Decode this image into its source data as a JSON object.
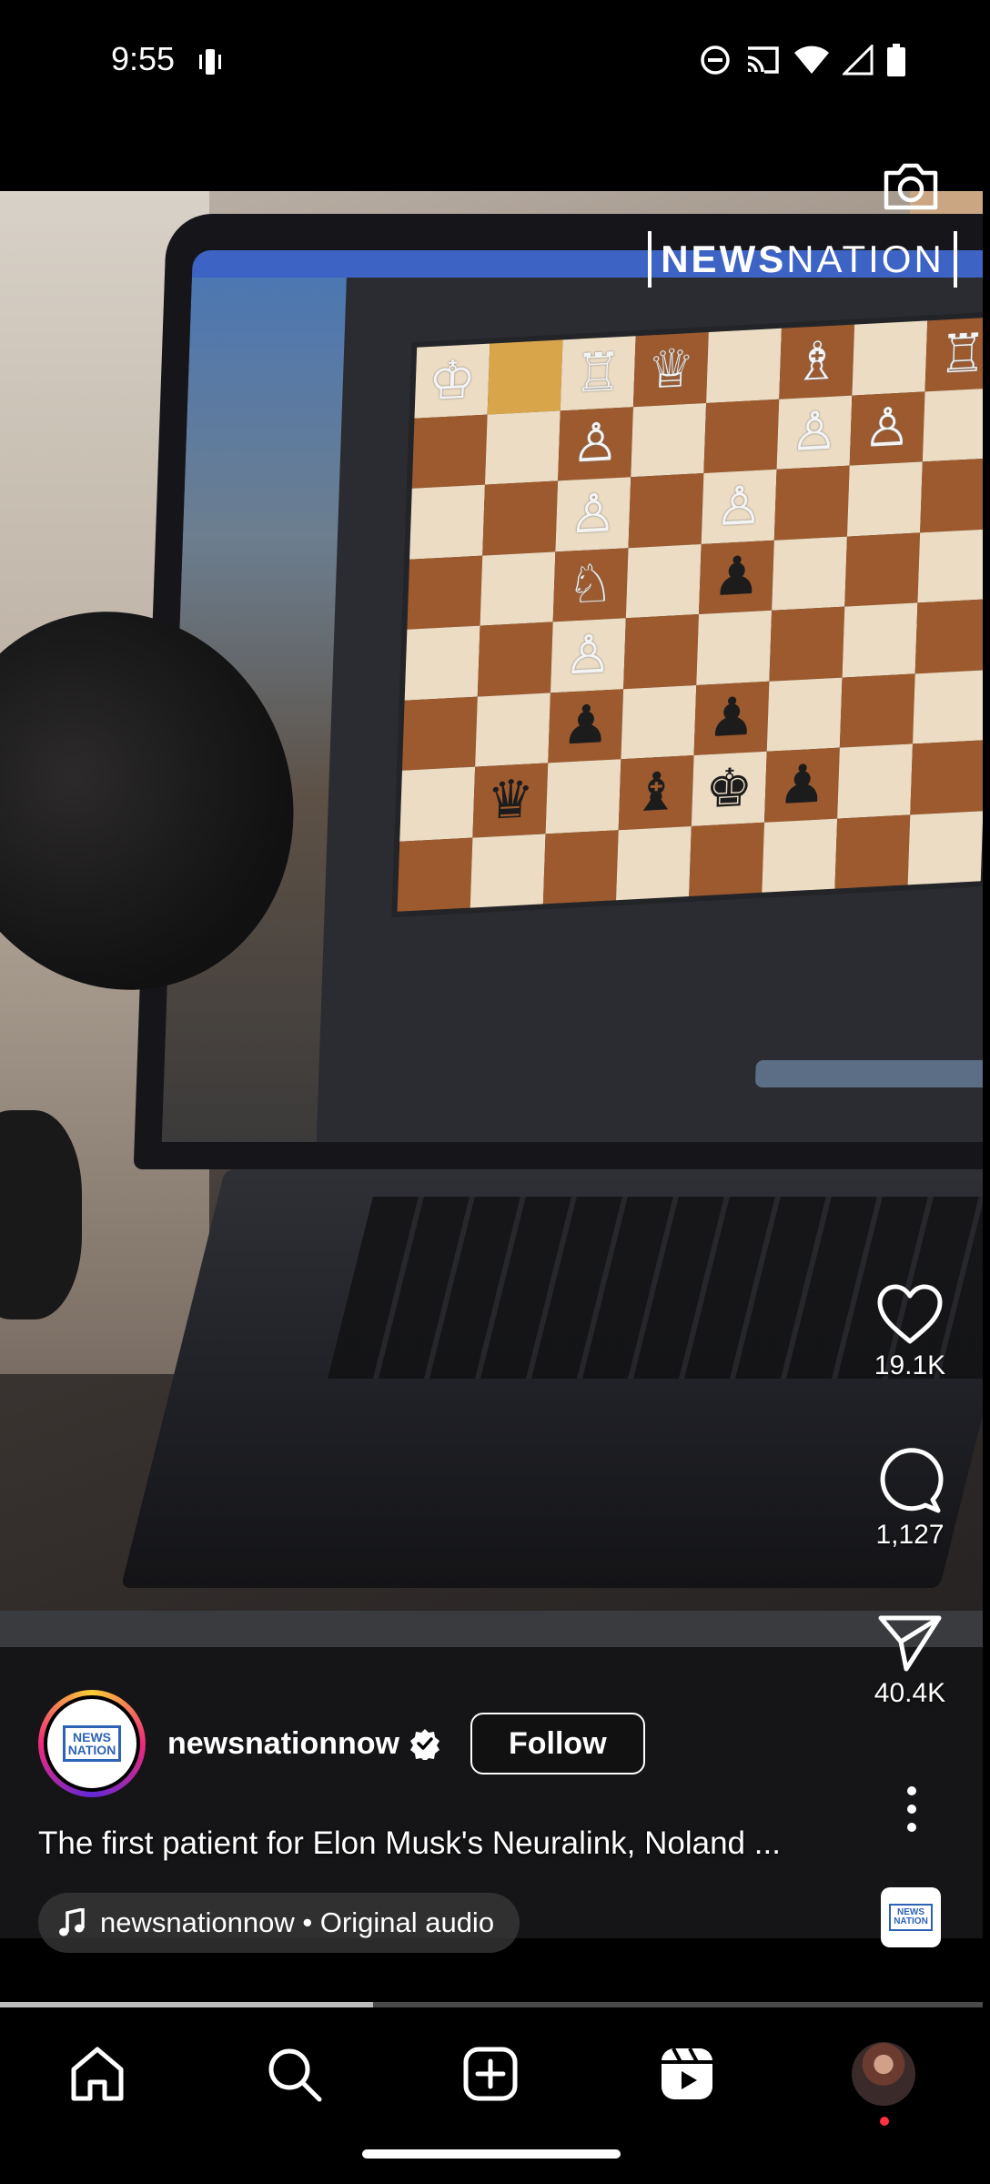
{
  "status_bar": {
    "time": "9:55",
    "icons": [
      "vibrate-icon",
      "do-not-disturb-icon",
      "cast-icon",
      "wifi-icon",
      "signal-icon",
      "battery-icon"
    ]
  },
  "video": {
    "watermark_bold": "NEWS",
    "watermark_thin": "NATION",
    "progress_fraction": 0.38
  },
  "actions": {
    "likes": "19.1K",
    "comments": "1,127",
    "shares": "40.4K"
  },
  "author": {
    "username": "newsnationnow",
    "avatar_logo_line1": "NEWS",
    "avatar_logo_line2": "NATION",
    "follow_label": "Follow"
  },
  "caption": "The first patient for Elon Musk's Neuralink, Noland ...",
  "audio": {
    "label": "newsnationnow • Original audio",
    "thumb_line1": "NEWS",
    "thumb_line2": "NATION"
  },
  "bottom_nav": {
    "items": [
      "home-icon",
      "search-icon",
      "create-icon",
      "reels-icon",
      "profile-avatar"
    ]
  },
  "colors": {
    "background": "#000000",
    "accent_ring_start": "#f9ce34",
    "accent_ring_mid": "#ee2a7b",
    "notification_dot": "#ff3040",
    "logo_blue": "#2d63b6"
  }
}
